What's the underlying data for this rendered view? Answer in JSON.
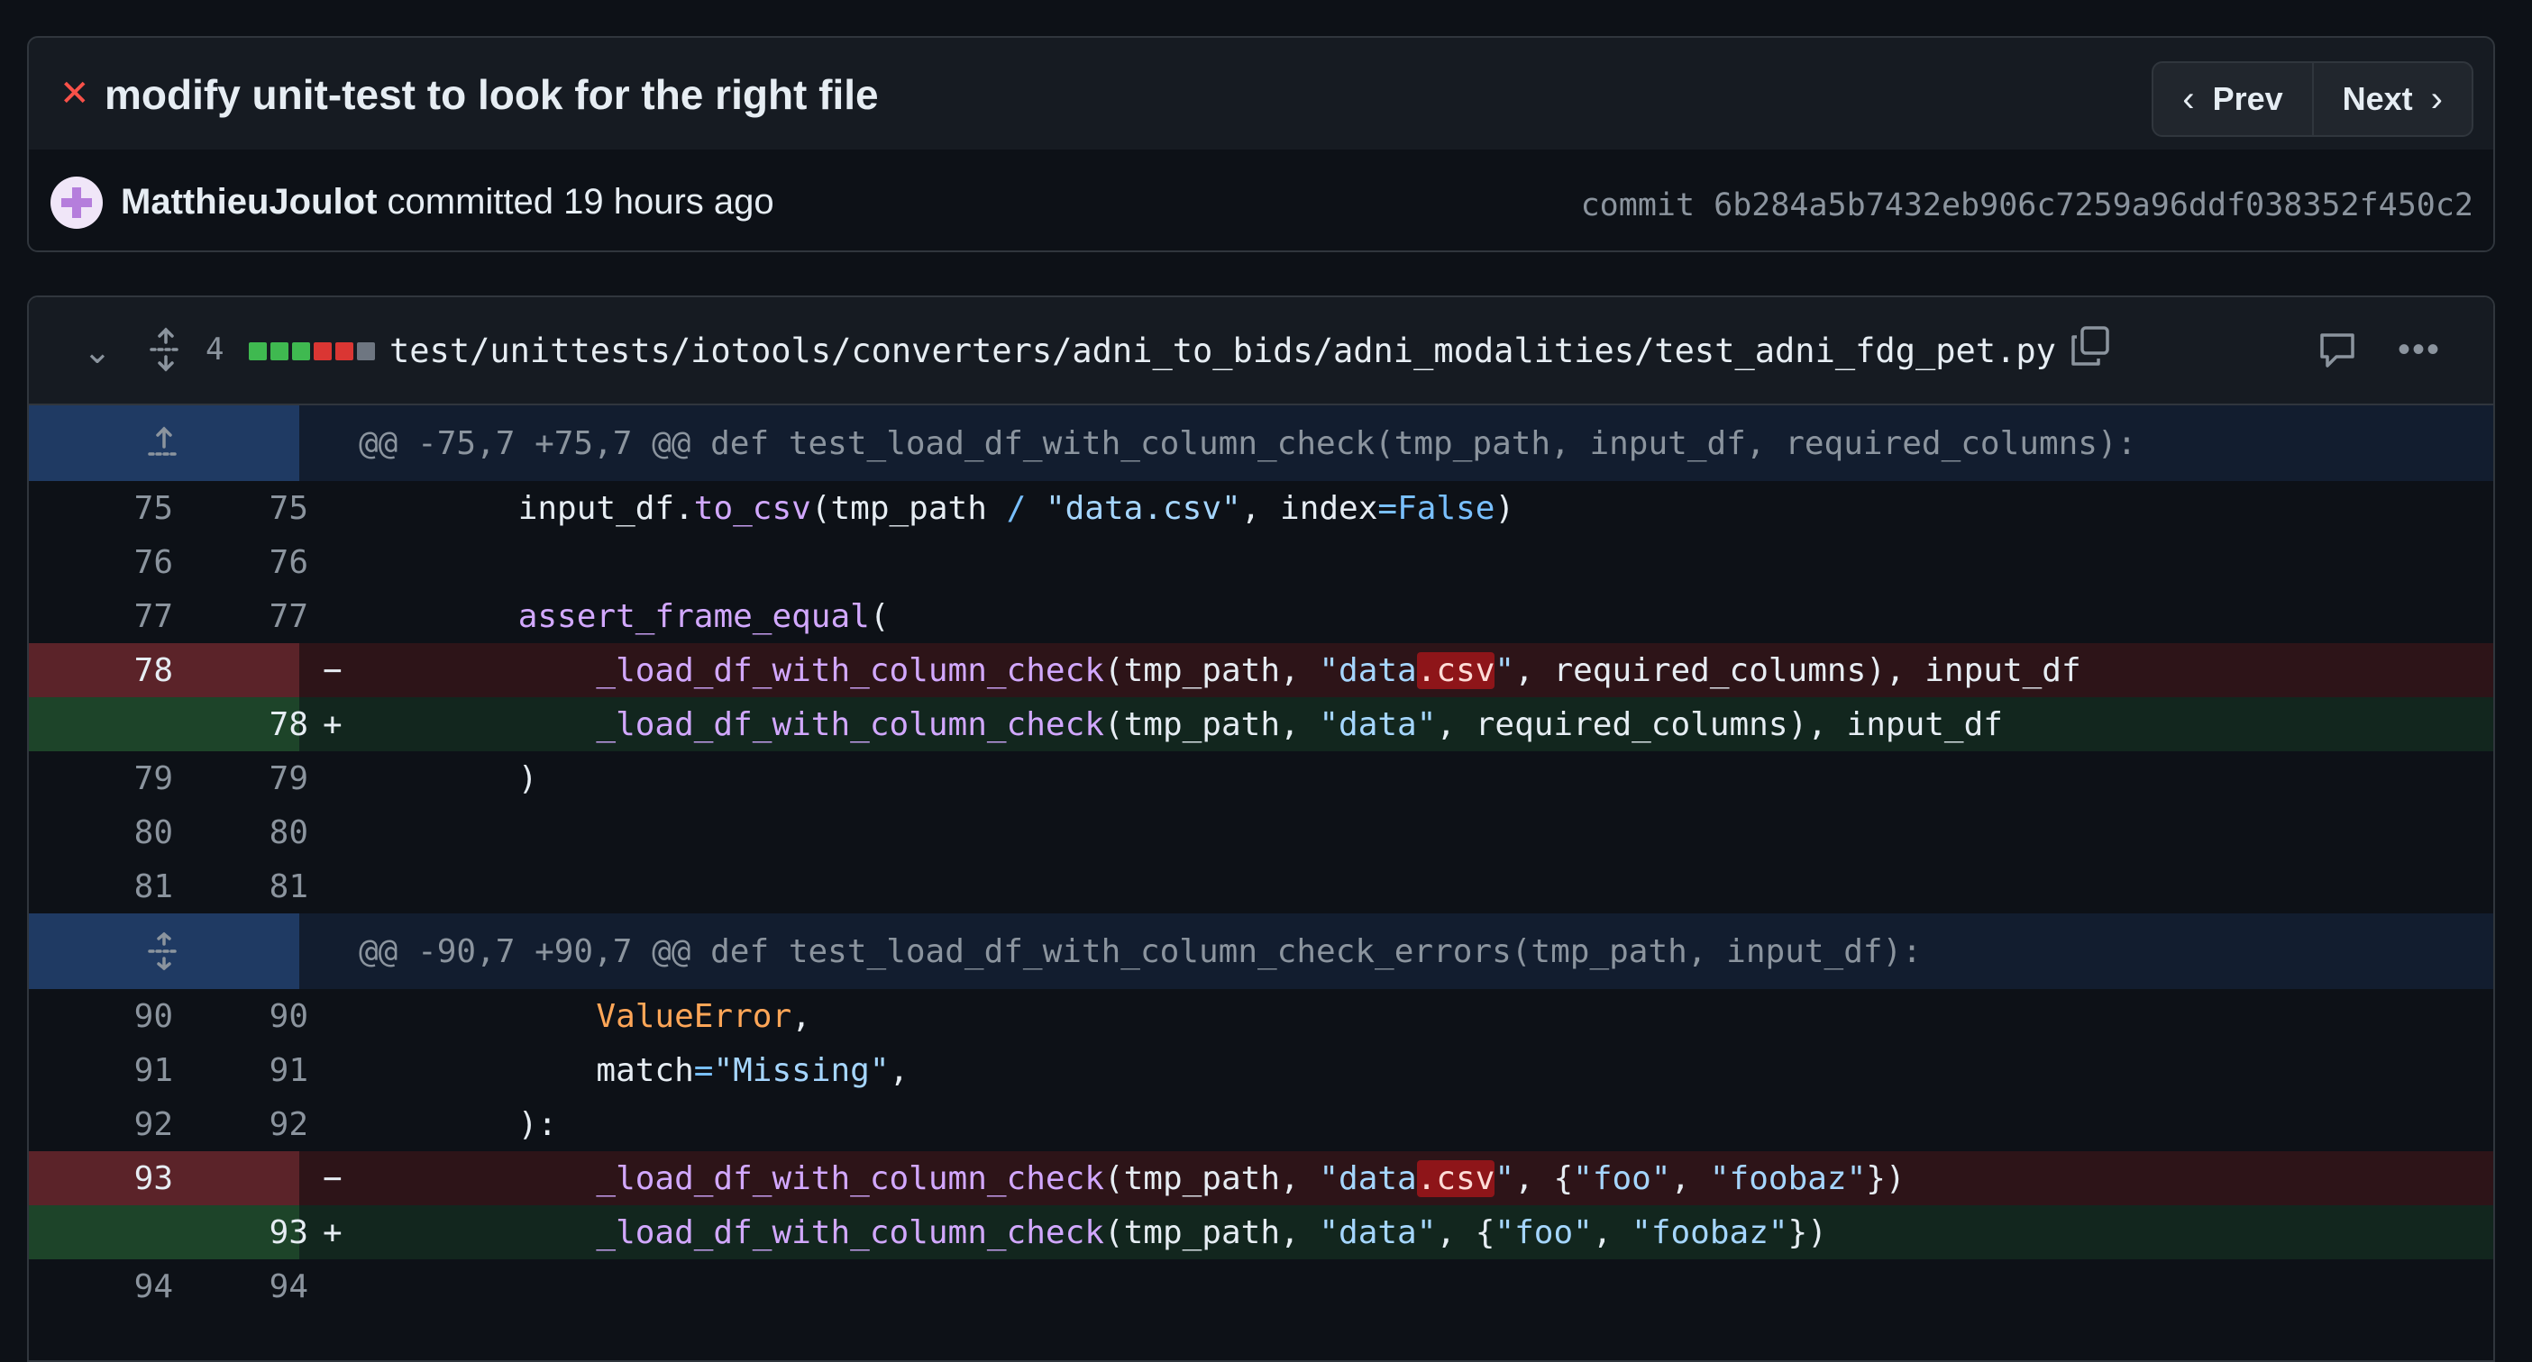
{
  "commit": {
    "status_icon": "x-icon",
    "title": "modify unit-test to look for the right file",
    "prev_label": "Prev",
    "next_label": "Next",
    "author": "MatthieuJoulot",
    "meta": " committed 19 hours ago",
    "sha_label": "commit ",
    "sha": "6b284a5b7432eb906c7259a96ddf038352f450c2"
  },
  "file": {
    "change_count": "4",
    "diffstat": [
      "add",
      "add",
      "add",
      "del",
      "del",
      "neutral"
    ],
    "path": "test/unittests/iotools/converters/adni_to_bids/adni_modalities/test_adni_fdg_pet.py"
  },
  "hunks": [
    {
      "header": "@@ -75,7 +75,7 @@ def test_load_df_with_column_check(tmp_path, input_df, required_columns):"
    },
    {
      "header": "@@ -90,7 +90,7 @@ def test_load_df_with_column_check_errors(tmp_path, input_df):"
    }
  ],
  "lines": [
    {
      "old": "75",
      "new": "75"
    },
    {
      "old": "76",
      "new": "76"
    },
    {
      "old": "77",
      "new": "77"
    },
    {
      "old": "78",
      "new": "",
      "sign": "−"
    },
    {
      "old": "",
      "new": "78",
      "sign": "+"
    },
    {
      "old": "79",
      "new": "79"
    },
    {
      "old": "80",
      "new": "80"
    },
    {
      "old": "81",
      "new": "81"
    },
    {
      "old": "90",
      "new": "90"
    },
    {
      "old": "91",
      "new": "91"
    },
    {
      "old": "92",
      "new": "92"
    },
    {
      "old": "93",
      "new": "",
      "sign": "−"
    },
    {
      "old": "",
      "new": "93",
      "sign": "+"
    },
    {
      "old": "94",
      "new": "94"
    }
  ],
  "tokens": {
    "l75": [
      "    input_df.",
      "to_csv",
      "(tmp_path ",
      "/",
      " ",
      "\"data.csv\"",
      ", index",
      "=",
      "False",
      ")"
    ],
    "l77": [
      "    ",
      "assert_frame_equal",
      "("
    ],
    "l78d": [
      "        ",
      "_load_df_with_column_check",
      "(tmp_path, ",
      "\"data",
      ".csv",
      "\"",
      ", required_columns), input_df"
    ],
    "l78a": [
      "        ",
      "_load_df_with_column_check",
      "(tmp_path, ",
      "\"data\"",
      ", required_columns), input_df"
    ],
    "l79": [
      "    )"
    ],
    "l90": [
      "        ",
      "ValueError",
      ","
    ],
    "l91": [
      "        match",
      "=",
      "\"Missing\"",
      ","
    ],
    "l92": [
      "    ):"
    ],
    "l93d": [
      "        ",
      "_load_df_with_column_check",
      "(tmp_path, ",
      "\"data",
      ".csv",
      "\"",
      ", {",
      "\"foo\"",
      ", ",
      "\"foobaz\"",
      "})"
    ],
    "l93a": [
      "        ",
      "_load_df_with_column_check",
      "(tmp_path, ",
      "\"data\"",
      ", {",
      "\"foo\"",
      ", ",
      "\"foobaz\"",
      "})"
    ]
  },
  "colors": {
    "add": "#3fb950",
    "del": "#da3633",
    "neutral": "#6e7681"
  }
}
